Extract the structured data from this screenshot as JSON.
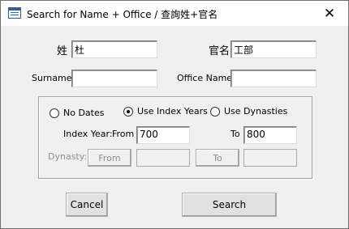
{
  "window": {
    "title": "Search for Name + Office / 查詢姓+官名",
    "app_icon": "form-icon",
    "close_icon": "close-icon",
    "close_glyph": "✕"
  },
  "name_fields": {
    "chinese_name_label": "姓",
    "chinese_name_value": "杜",
    "chinese_office_label": "官名",
    "chinese_office_value": "工部",
    "surname_label": "Surname:",
    "surname_value": "",
    "office_name_label": "Office Name:",
    "office_name_value": ""
  },
  "date_options": {
    "selected": "Use Index Years",
    "options": [
      "No Dates",
      "Use Index Years",
      "Use Dynasties"
    ],
    "index_year_label": "Index Year:",
    "from_label": "From",
    "from_value": "700",
    "to_label": "To",
    "to_value": "800",
    "dynasty_label": "Dynasty:",
    "dynasty_from_button": "From",
    "dynasty_from_value": "",
    "dynasty_to_button": "To",
    "dynasty_to_value": ""
  },
  "actions": {
    "cancel_label": "Cancel",
    "search_label": "Search"
  }
}
